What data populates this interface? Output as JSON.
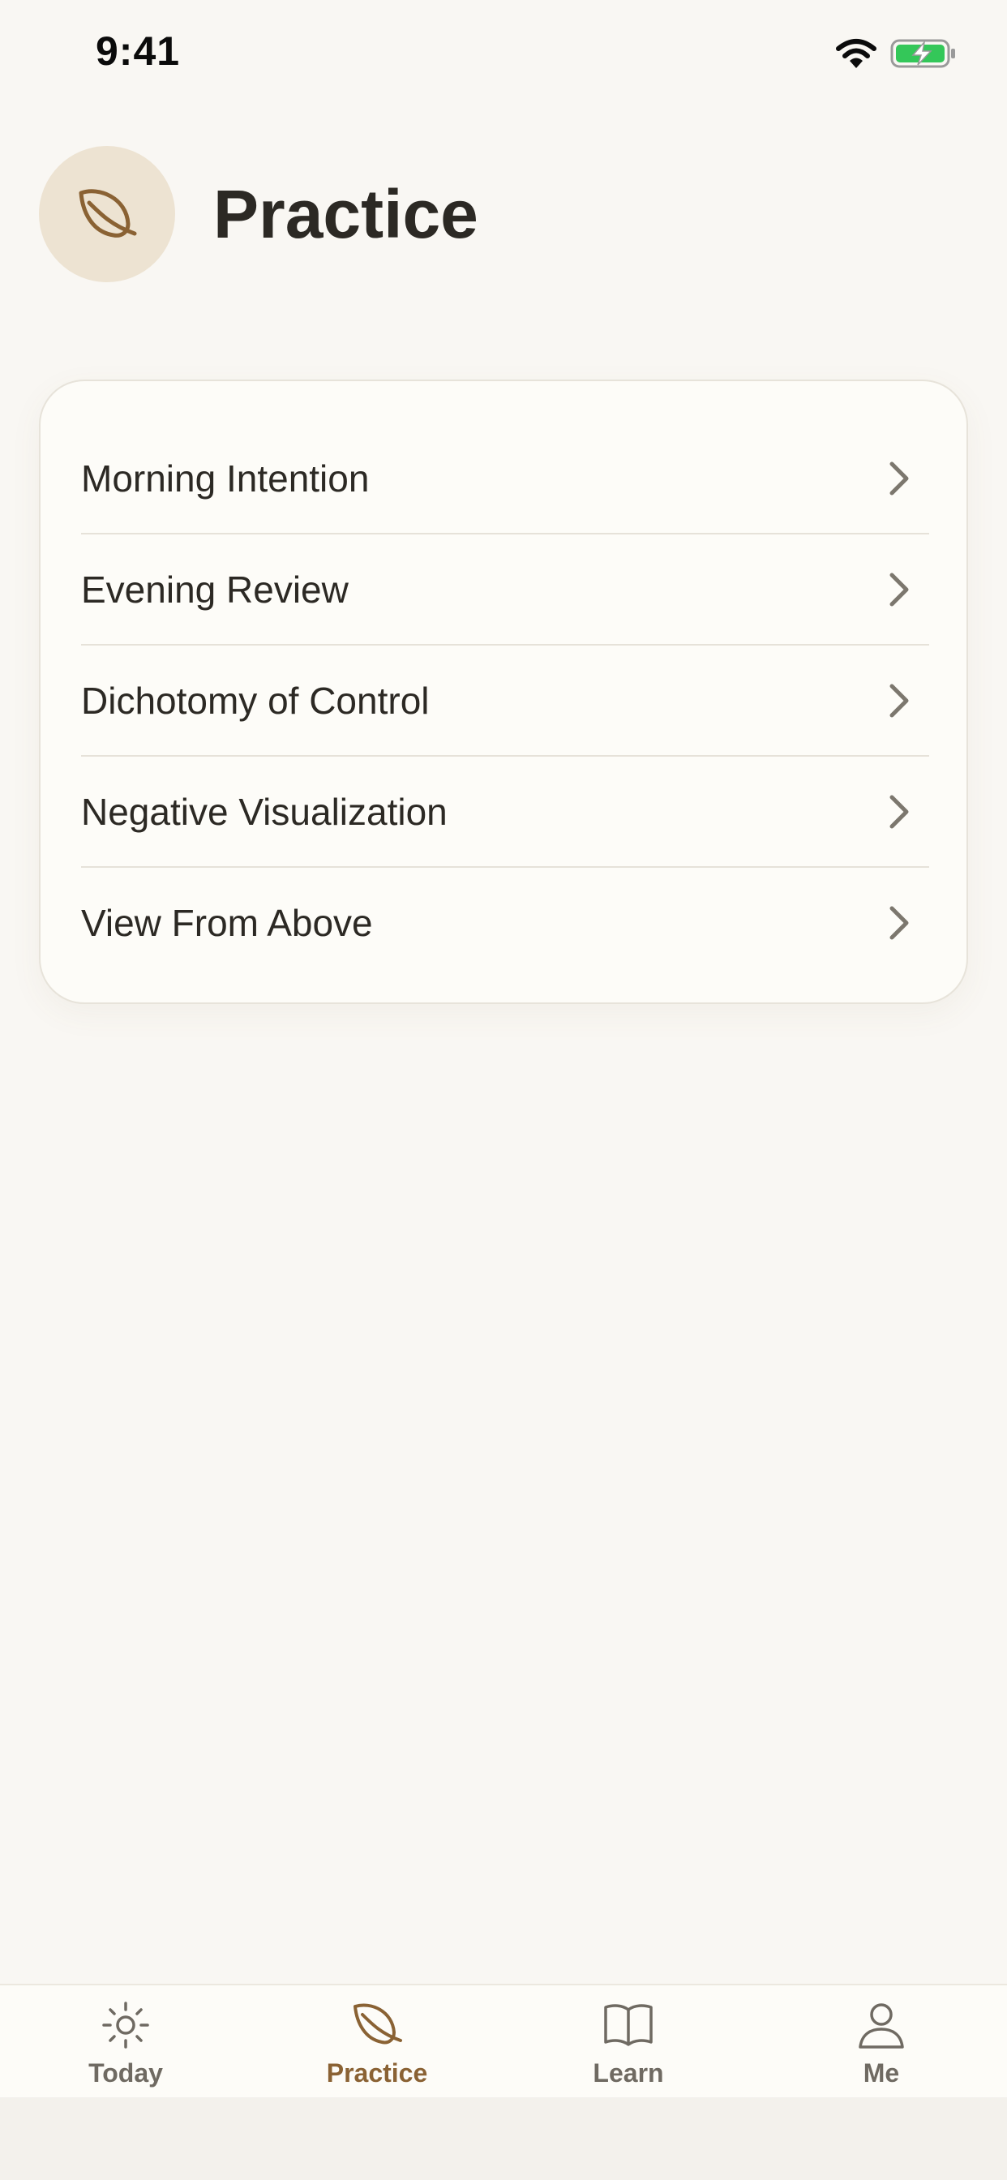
{
  "status_bar": {
    "time": "9:41"
  },
  "header": {
    "title": "Practice",
    "icon": "leaf-icon"
  },
  "practice_list": {
    "items": [
      {
        "label": "Morning Intention"
      },
      {
        "label": "Evening Review"
      },
      {
        "label": "Dichotomy of Control"
      },
      {
        "label": "Negative Visualization"
      },
      {
        "label": "View From Above"
      }
    ]
  },
  "tab_bar": {
    "tabs": [
      {
        "label": "Today",
        "icon": "sun-icon",
        "active": false
      },
      {
        "label": "Practice",
        "icon": "leaf-icon",
        "active": true
      },
      {
        "label": "Learn",
        "icon": "book-icon",
        "active": false
      },
      {
        "label": "Me",
        "icon": "person-icon",
        "active": false
      }
    ]
  },
  "colors": {
    "accent": "#8a6234",
    "background": "#f9f7f3",
    "card": "#fdfcf8",
    "battery": "#34c759"
  }
}
